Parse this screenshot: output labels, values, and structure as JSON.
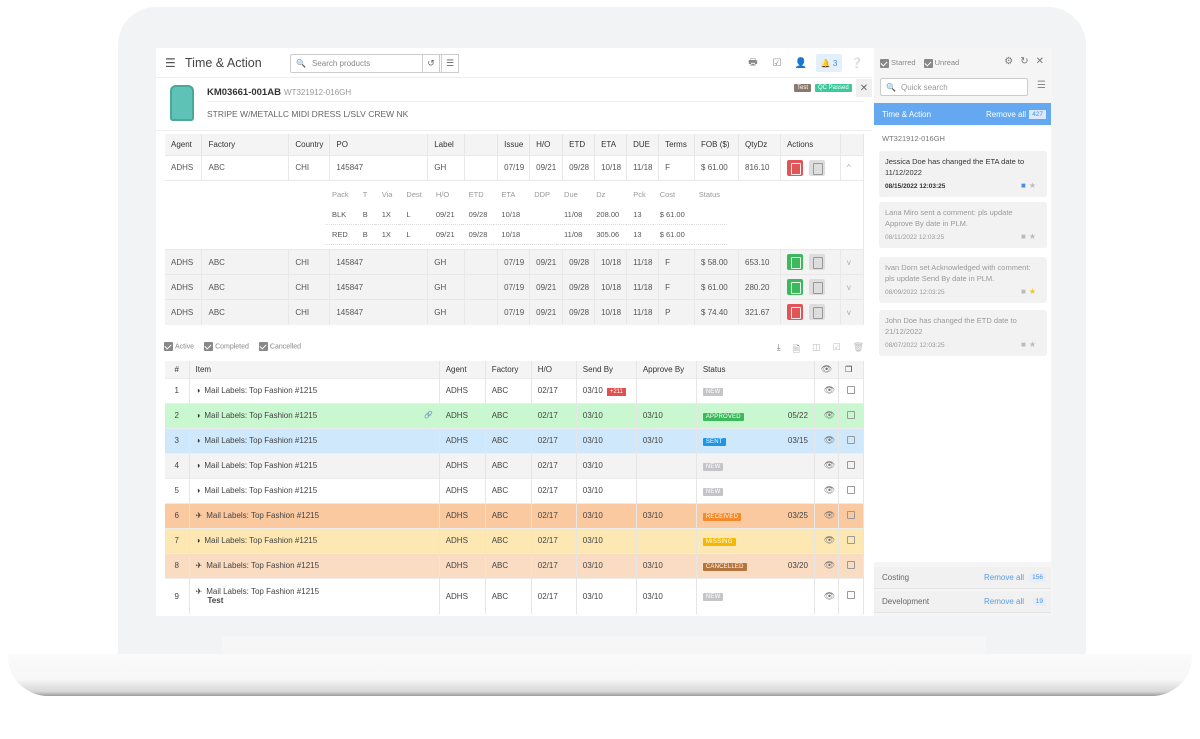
{
  "app": {
    "title": "Time & Action",
    "search_placeholder": "Search products",
    "notif_count": "3"
  },
  "product": {
    "code": "KM03661-001AB",
    "ref": "WT321912-016GH",
    "description": "STRIPE W/METALLC MIDI DRESS L/SLV CREW NK",
    "tags": [
      "Test",
      "QC Passed"
    ]
  },
  "po_table": {
    "headers": [
      "Agent",
      "Factory",
      "Country",
      "PO",
      "Label",
      "",
      "Issue",
      "H/O",
      "ETD",
      "ETA",
      "DUE",
      "Terms",
      "FOB ($)",
      "QtyDz",
      "Actions",
      ""
    ],
    "rows": [
      {
        "agent": "ADHS",
        "factory": "ABC",
        "country": "CHI",
        "po": "145847",
        "label": "GH",
        "issue": "07/19",
        "ho": "09/21",
        "etd": "09/28",
        "eta": "10/18",
        "due": "11/18",
        "terms": "F",
        "fob": "$ 61.00",
        "qty": "816.10",
        "action": "red",
        "expanded": true
      },
      {
        "agent": "ADHS",
        "factory": "ABC",
        "country": "CHI",
        "po": "145847",
        "label": "GH",
        "issue": "07/19",
        "ho": "09/21",
        "etd": "09/28",
        "eta": "10/18",
        "due": "11/18",
        "terms": "F",
        "fob": "$ 58.00",
        "qty": "653.10",
        "action": "green"
      },
      {
        "agent": "ADHS",
        "factory": "ABC",
        "country": "CHI",
        "po": "145847",
        "label": "GH",
        "issue": "07/19",
        "ho": "09/21",
        "etd": "09/28",
        "eta": "10/18",
        "due": "11/18",
        "terms": "F",
        "fob": "$ 61.00",
        "qty": "280.20",
        "action": "green"
      },
      {
        "agent": "ADHS",
        "factory": "ABC",
        "country": "CHI",
        "po": "145847",
        "label": "GH",
        "issue": "07/19",
        "ho": "09/21",
        "etd": "09/28",
        "eta": "10/18",
        "due": "11/18",
        "terms": "P",
        "fob": "$ 74.40",
        "qty": "321.67",
        "action": "red"
      }
    ],
    "sub_headers": [
      "Pack",
      "T",
      "Via",
      "Dest",
      "H/O",
      "ETD",
      "ETA",
      "DDP",
      "Due",
      "Dz",
      "Pck",
      "Cost",
      "Status"
    ],
    "sub_rows": [
      [
        "BLK",
        "B",
        "1X",
        "L",
        "09/21",
        "09/28",
        "10/18",
        "",
        "11/08",
        "208.00",
        "13",
        "$ 61.00",
        ""
      ],
      [
        "RED",
        "B",
        "1X",
        "L",
        "09/21",
        "09/28",
        "10/18",
        "",
        "11/08",
        "305.06",
        "13",
        "$ 61.00",
        ""
      ]
    ]
  },
  "filters": [
    "Active",
    "Completed",
    "Cancelled"
  ],
  "task_table": {
    "headers": [
      "#",
      "Item",
      "Agent",
      "Factory",
      "H/O",
      "Send By",
      "Approve By",
      "Status",
      "",
      ""
    ],
    "rows": [
      {
        "n": "1",
        "icon": "half-circle",
        "item": "Mail Labels: Top Fashion #1215",
        "agent": "ADHS",
        "factory": "ABC",
        "ho": "02/17",
        "send": "03/10",
        "late": "+211",
        "approve": "",
        "status": "NEW",
        "sdate": "",
        "bg": "#ffffff"
      },
      {
        "n": "2",
        "icon": "half-circle",
        "item": "Mail Labels: Top Fashion #1215",
        "agent": "ADHS",
        "factory": "ABC",
        "ho": "02/17",
        "send": "03/10",
        "late": "",
        "approve": "03/10",
        "status": "APPROVED",
        "sdate": "05/22",
        "bg": "#c8f7d0",
        "link": true
      },
      {
        "n": "3",
        "icon": "half-circle",
        "item": "Mail Labels: Top Fashion #1215",
        "agent": "ADHS",
        "factory": "ABC",
        "ho": "02/17",
        "send": "03/10",
        "late": "",
        "approve": "03/10",
        "status": "SENT",
        "sdate": "03/15",
        "bg": "#cfe8fb"
      },
      {
        "n": "4",
        "icon": "half-circle",
        "item": "Mail Labels: Top Fashion #1215",
        "agent": "ADHS",
        "factory": "ABC",
        "ho": "02/17",
        "send": "03/10",
        "late": "",
        "approve": "",
        "status": "NEW",
        "sdate": "",
        "bg": "#f3f3f4"
      },
      {
        "n": "5",
        "icon": "half-circle",
        "item": "Mail Labels: Top Fashion #1215",
        "agent": "ADHS",
        "factory": "ABC",
        "ho": "02/17",
        "send": "03/10",
        "late": "",
        "approve": "",
        "status": "NEW",
        "sdate": "",
        "bg": "#ffffff"
      },
      {
        "n": "6",
        "icon": "plane",
        "item": "Mail Labels: Top Fashion #1215",
        "agent": "ADHS",
        "factory": "ABC",
        "ho": "02/17",
        "send": "03/10",
        "late": "",
        "approve": "03/10",
        "status": "RECEIVED",
        "sdate": "03/25",
        "bg": "#fbc9a0"
      },
      {
        "n": "7",
        "icon": "half-circle",
        "item": "Mail Labels: Top Fashion #1215",
        "agent": "ADHS",
        "factory": "ABC",
        "ho": "02/17",
        "send": "03/10",
        "late": "",
        "approve": "",
        "status": "MISSING",
        "sdate": "",
        "bg": "#fde7b3"
      },
      {
        "n": "8",
        "icon": "plane",
        "item": "Mail Labels: Top Fashion #1215",
        "agent": "ADHS",
        "factory": "ABC",
        "ho": "02/17",
        "send": "03/10",
        "late": "",
        "approve": "03/10",
        "status": "CANCELLED",
        "sdate": "03/20",
        "bg": "#f9dcc2"
      },
      {
        "n": "9",
        "icon": "plane",
        "item": "Mail Labels: Top Fashion #1215",
        "sub": "Test",
        "agent": "ADHS",
        "factory": "ABC",
        "ho": "02/17",
        "send": "03/10",
        "late": "",
        "approve": "03/10",
        "status": "NEW",
        "sdate": "",
        "bg": "#ffffff"
      }
    ],
    "status_colors": {
      "NEW": "#c5c5c8",
      "APPROVED": "#3cb95a",
      "SENT": "#1e96e6",
      "RECEIVED": "#f58a2b",
      "MISSING": "#f5b800",
      "CANCELLED": "#b5743b"
    }
  },
  "sidebar": {
    "starred": "Starred",
    "unread": "Unread",
    "search_placeholder": "Quick search",
    "active_section": {
      "title": "Time & Action",
      "remove": "Remove all",
      "count": "427"
    },
    "ref": "WT321912-016GH",
    "notes": [
      {
        "text": "Jessica Doe has changed the ETA date to 11/12/2022",
        "date": "08/15/2022 12:03:25",
        "unread": true,
        "starred": false
      },
      {
        "text": "Lana Miro sent a comment: pls update Approve By date in PLM.",
        "date": "08/11/2022 12:03:25",
        "unread": false,
        "starred": false
      },
      {
        "text": "Ivan Dorn set Acknowledged with comment: pls update Send By date in PLM.",
        "date": "08/09/2022 12:03:25",
        "unread": false,
        "starred": true
      },
      {
        "text": "John Doe has changed the ETD date to 21/12/2022",
        "date": "08/07/2022 12:03:25",
        "unread": false,
        "starred": false
      }
    ],
    "sections": [
      {
        "title": "Costing",
        "remove": "Remove all",
        "count": "156"
      },
      {
        "title": "Development",
        "remove": "Remove all",
        "count": "19"
      }
    ]
  }
}
